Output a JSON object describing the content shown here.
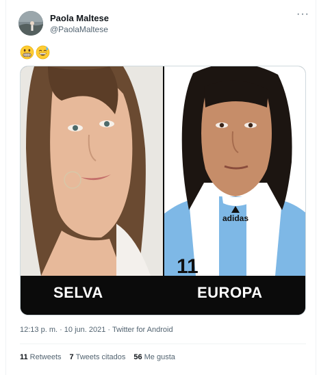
{
  "tweet": {
    "author_name": "Paola Maltese",
    "author_handle": "@PaolaMaltese",
    "more_icon": "more-horizontal-icon",
    "more_label": "···",
    "emojis": [
      "grimacing-face",
      "grinning-face-with-sweat"
    ],
    "media": {
      "left_caption": "SELVA",
      "right_caption": "EUROPA",
      "right_shirt_brand": "adidas"
    },
    "timestamp": "12:13 p. m. · 10 jun. 2021 · Twitter for Android",
    "stats": {
      "retweets_count": "11",
      "retweets_label": "Retweets",
      "quotes_count": "7",
      "quotes_label": "Tweets citados",
      "likes_count": "56",
      "likes_label": "Me gusta"
    }
  }
}
